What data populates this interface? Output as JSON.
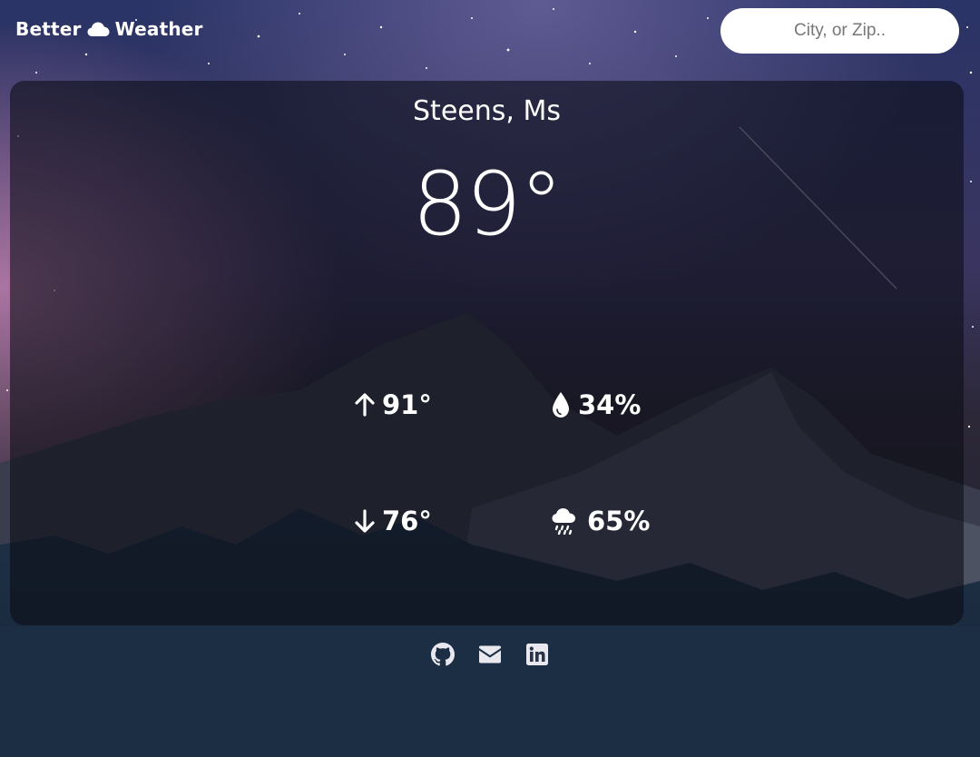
{
  "header": {
    "brand_left": "Better",
    "brand_right": "Weather",
    "brand_icon": "cloud-icon",
    "search_placeholder": "City, or Zip.."
  },
  "weather": {
    "city": "Steens, Ms",
    "temperature": "89°",
    "high": "91°",
    "low": "76°",
    "humidity": "34%",
    "precipitation": "65%"
  },
  "icons": {
    "high": "arrow-up-icon",
    "low": "arrow-down-icon",
    "humidity": "droplet-icon",
    "precipitation": "cloud-rain-icon"
  },
  "footer": {
    "links": [
      "github-icon",
      "envelope-icon",
      "linkedin-icon"
    ]
  },
  "colors": {
    "text": "#ffffff",
    "card": "rgba(10,12,20,0.58)",
    "search_bg": "#ffffff"
  }
}
